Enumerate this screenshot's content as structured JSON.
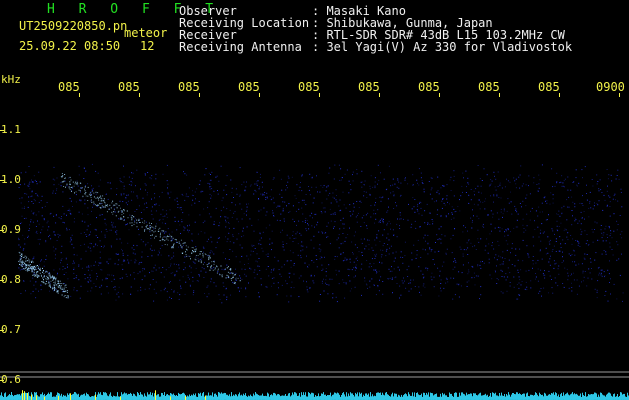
{
  "header": {
    "app_name": "H R O F F T",
    "filename": "UT2509220850.pn",
    "tag": "meteor",
    "datetime": "25.09.22 08:50",
    "count": "12",
    "info": [
      {
        "label": "Observer",
        "value": ": Masaki Kano"
      },
      {
        "label": "Receiving Location",
        "value": ": Shibukawa, Gunma, Japan"
      },
      {
        "label": "Receiver",
        "value": ": RTL-SDR SDR# 43dB L15 103.2MHz CW"
      },
      {
        "label": "Receiving Antenna",
        "value": ": 3el Yagi(V) Az 330 for Vladivostok"
      }
    ]
  },
  "spectrogram": {
    "y_unit": "kHz",
    "y_ticks": [
      "1.1",
      "1.0",
      "0.9",
      "0.8",
      "0.7",
      "0.6"
    ],
    "x_ticks": [
      "085",
      "085",
      "085",
      "085",
      "085",
      "085",
      "085",
      "085",
      "085",
      "0900"
    ],
    "colors": {
      "background": "#000000",
      "noise": "#2a3cff",
      "trace": "#a0d8ff",
      "bottom_bar": "#33ddff",
      "marker": "#ffff33",
      "label": "#f2f24a"
    }
  }
}
